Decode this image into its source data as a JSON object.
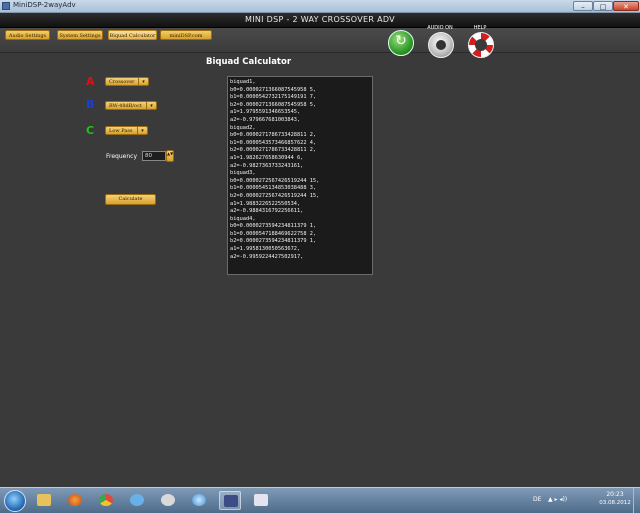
{
  "window": {
    "title": "MiniDSP-2wayAdv",
    "minimize_label": "–",
    "maximize_label": "□",
    "close_label": "✕"
  },
  "app": {
    "title": "MINI DSP - 2 WAY CROSSOVER ADV"
  },
  "tabs": [
    {
      "label": "Audio Settings"
    },
    {
      "label": "System Settings"
    },
    {
      "label": "Biquad Calculator"
    },
    {
      "label": "miniDSP.com"
    }
  ],
  "header_icons": {
    "audio_label": "AUDIO ON",
    "help_label": "HELP",
    "refresh_glyph": "↻"
  },
  "main": {
    "page_title": "Biquad Calculator",
    "letters": [
      "A",
      "B",
      "C"
    ],
    "dropdowns": [
      {
        "value": "Crossover"
      },
      {
        "value": "BW-48dB/oct"
      },
      {
        "value": "Low Pass"
      }
    ],
    "dropdown_arrow": "▾",
    "frequency_label": "Frequency",
    "frequency_value": "80",
    "stepper_glyph": "▲▼",
    "calculate_label": "Calculate"
  },
  "output_lines": [
    "biquad1,",
    "b0=0.0000271366087545958 5,",
    "b1=0.0000542732175149191 7,",
    "b2=0.0000271366087545958 5,",
    "a1=1.9795591346653545,",
    "a2=-0.979667681003843,",
    "biquad2,",
    "b0=0.0000271786733428811 2,",
    "b1=0.0000543573466857622 4,",
    "b2=0.0000271786733428811 2,",
    "a1=1.982627658630944 6,",
    "a2=-0.9827363733243161,",
    "biquad3,",
    "b0=0.0000272567426519244 15,",
    "b1=0.0000545134853038488 3,",
    "b2=0.0000272567426519244 15,",
    "a1=1.9883226522550534,",
    "a2=-0.9884316792256611,",
    "biquad4,",
    "b0=0.0000273594234811379 1,",
    "b1=0.0000547188469622758 2,",
    "b2=0.0000273594234811379 1,",
    "a1=1.9958130050563672,",
    "a2=-0.9959224427502917,"
  ],
  "taskbar": {
    "language": "DE",
    "tray": "▲ ▸ ◂))",
    "time": "20:23",
    "date": "03.08.2012"
  }
}
